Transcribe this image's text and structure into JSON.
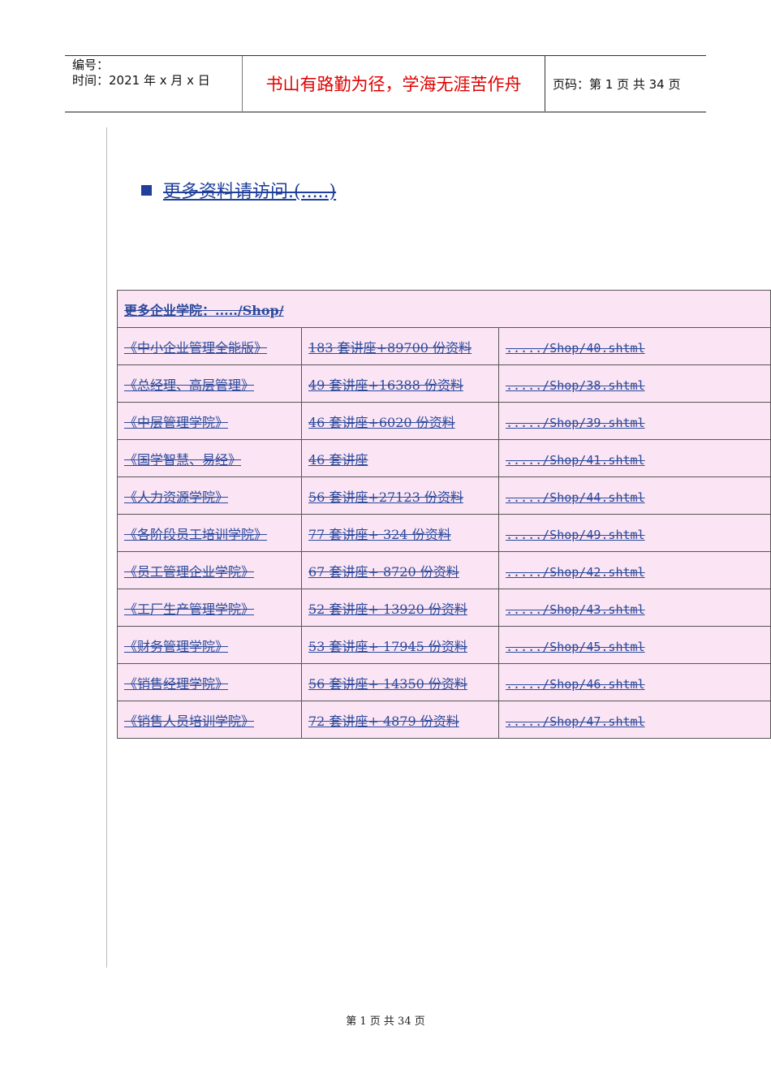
{
  "header": {
    "number_label": "编号：",
    "time_label": "时间：2021 年 x 月 x 日",
    "motto": "书山有路勤为径，学海无涯苦作舟",
    "page_info": "页码：第 1 页  共 34 页"
  },
  "more_link": "更多资料请访问.(.....)",
  "table": {
    "header": "更多企业学院：...../Shop/",
    "rows": [
      [
        "《中小企业管理全能版》",
        "183 套讲座+89700 份资料",
        "...../Shop/40.shtml"
      ],
      [
        "《总经理、高层管理》",
        "49 套讲座+16388 份资料",
        "...../Shop/38.shtml"
      ],
      [
        "《中层管理学院》",
        "46 套讲座+6020 份资料",
        "...../Shop/39.shtml"
      ],
      [
        "《国学智慧、易经》",
        "46 套讲座",
        "...../Shop/41.shtml"
      ],
      [
        "《人力资源学院》",
        "56 套讲座+27123 份资料",
        "...../Shop/44.shtml"
      ],
      [
        "《各阶段员工培训学院》",
        "77 套讲座+ 324 份资料",
        "...../Shop/49.shtml"
      ],
      [
        "《员工管理企业学院》",
        "67 套讲座+ 8720 份资料",
        "...../Shop/42.shtml"
      ],
      [
        "《工厂生产管理学院》",
        "52 套讲座+ 13920 份资料",
        "...../Shop/43.shtml"
      ],
      [
        "《财务管理学院》",
        "53 套讲座+ 17945 份资料",
        "...../Shop/45.shtml"
      ],
      [
        "《销售经理学院》",
        "56 套讲座+ 14350 份资料",
        "...../Shop/46.shtml"
      ],
      [
        "《销售人员培训学院》",
        "72 套讲座+ 4879 份资料",
        "...../Shop/47.shtml"
      ]
    ]
  },
  "footer": "第 1 页 共 34 页"
}
